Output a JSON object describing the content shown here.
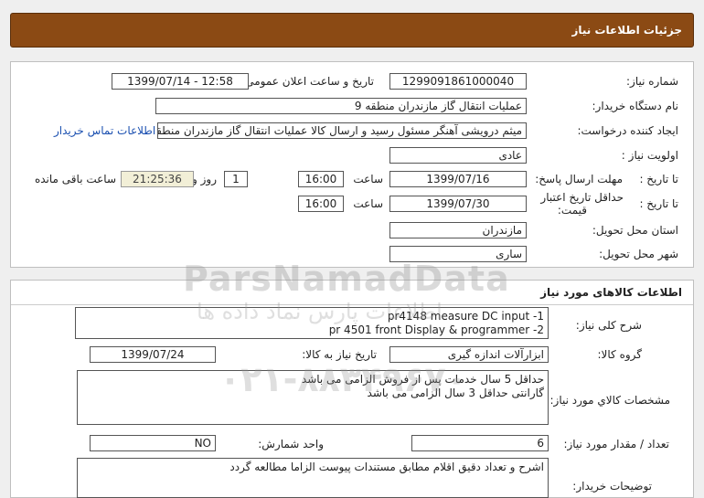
{
  "header": {
    "title": "جزئیات اطلاعات نیاز"
  },
  "info": {
    "need_number_label": "شماره نیاز:",
    "need_number": "1299091861000040",
    "announce_label": "تاریخ و ساعت اعلان عمومی:",
    "announce_value": "1399/07/14 - 12:58",
    "buyer_label": "نام دستگاه خریدار:",
    "buyer_value": "عملیات انتقال گاز مازندران منطقه 9",
    "requester_label": "ایجاد کننده درخواست:",
    "requester_value": "میثم درویشی آهنگر مسئول رسید و ارسال کالا عملیات انتقال گاز مازندران منطقه",
    "contact_link": "اطلاعات تماس خریدار",
    "priority_label": "اولویت نیاز :",
    "priority_value": "عادی",
    "deadline_label": "مهلت ارسال پاسخ:",
    "to_date_label": "تا تاریخ :",
    "deadline_date": "1399/07/16",
    "hour_label": "ساعت",
    "deadline_time": "16:00",
    "days_value": "1",
    "days_label": "روز و",
    "remaining_time": "21:25:36",
    "remaining_label": "ساعت باقی مانده",
    "validity_label_1": "حداقل تاریخ اعتبار",
    "validity_label_2": "قیمت:",
    "validity_date": "1399/07/30",
    "validity_time": "16:00",
    "province_label": "استان محل تحویل:",
    "province_value": "مازندران",
    "city_label": "شهر محل تحویل:",
    "city_value": "ساری"
  },
  "goods": {
    "section_title": "اطلاعات کالاهای مورد نیاز",
    "summary_label": "شرح کلی نیاز:",
    "summary_value": "pr4148 measure DC input -1\npr 4501 front Display & programmer -2",
    "group_label": "گروه کالا:",
    "group_value": "ابزارآلات اندازه گیری",
    "need_date_label": "تاریخ نیاز به کالا:",
    "need_date_value": "1399/07/24",
    "specs_label": "مشخصات کالاي مورد نیاز:",
    "specs_value": "حداقل 5 سال خدمات پس از فروش الزامی می باشد\nگارانتی حداقل 3 سال الزامی می باشد",
    "qty_label": "تعداد / مقدار مورد نیاز:",
    "qty_value": "6",
    "unit_label": "واحد شمارش:",
    "unit_value": "NO",
    "notes_label": "توضیحات خریدار:",
    "notes_value": "اشرح و تعداد دقیق اقلام مطابق مستندات پیوست الزاما مطالعه گردد"
  },
  "watermark": {
    "line1": "ParsNamadData",
    "line2": "اطلاعات پارس نماد داده ها",
    "line3": "۰۲۱-۸۸۳۴۹۶۷۰"
  }
}
